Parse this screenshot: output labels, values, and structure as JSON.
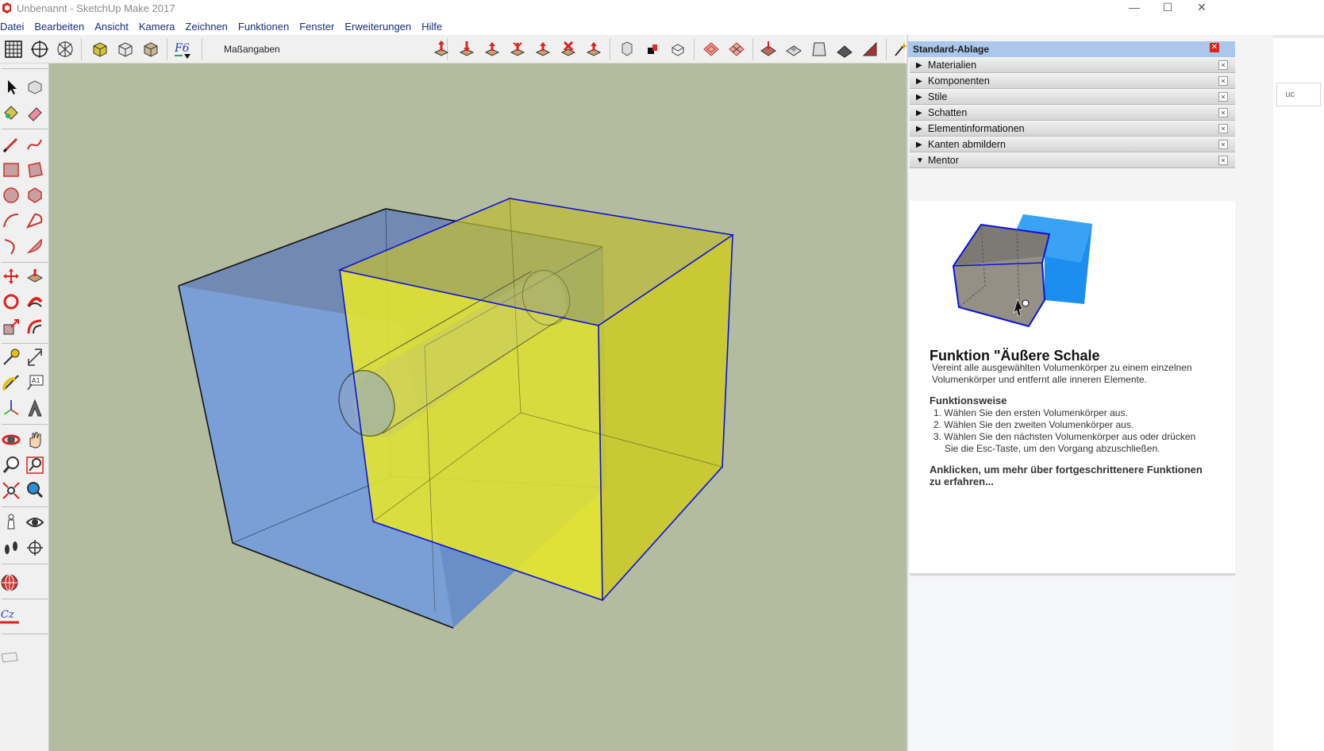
{
  "window": {
    "title": "Unbenannt - SketchUp Make 2017",
    "min_glyph": "—",
    "max_glyph": "☐",
    "close_glyph": "✕"
  },
  "menu": [
    "Datei",
    "Bearbeiten",
    "Ansicht",
    "Kamera",
    "Zeichnen",
    "Funktionen",
    "Fenster",
    "Erweiterungen",
    "Hilfe"
  ],
  "toolbar": {
    "measurements_label": "Maßangaben"
  },
  "tray": {
    "title": "Standard-Ablage",
    "close_glyph": "✕",
    "panels": [
      {
        "label": "Materialien",
        "expanded": false
      },
      {
        "label": "Komponenten",
        "expanded": false
      },
      {
        "label": "Stile",
        "expanded": false
      },
      {
        "label": "Schatten",
        "expanded": false
      },
      {
        "label": "Elementinformationen",
        "expanded": false
      },
      {
        "label": "Kanten abmildern",
        "expanded": false
      },
      {
        "label": "Mentor",
        "expanded": true
      }
    ],
    "collapsed_glyph": "▶",
    "expanded_glyph": "▼",
    "panel_close_glyph": "×"
  },
  "mentor": {
    "title": "Funktion \"Äußere Schale",
    "description": "Vereint alle ausgewählten Volumenkörper zu einem einzelnen Volumenkörper und entfernt alle inneren Elemente.",
    "subheading": "Funktionsweise",
    "steps": [
      "1. Wählen Sie den ersten Volumenkörper aus.",
      "2. Wählen Sie den zweiten Volumenkörper aus.",
      "3. Wählen Sie den nächsten Volumenkörper aus oder drücken",
      "Sie die Esc-Taste, um den Vorgang abzuschließen."
    ],
    "link": "Anklicken, um mehr über fortgeschrittenere Funktionen zu erfahren..."
  },
  "right_strip": {
    "field_text": "uc"
  },
  "colors": {
    "viewport_bg": "#b3bc9e",
    "blue_solid": "#7a9fd6",
    "yellow_solid": "#e6e62a",
    "selection": "#1010d8",
    "tray_title_bg": "#abc7eb"
  }
}
